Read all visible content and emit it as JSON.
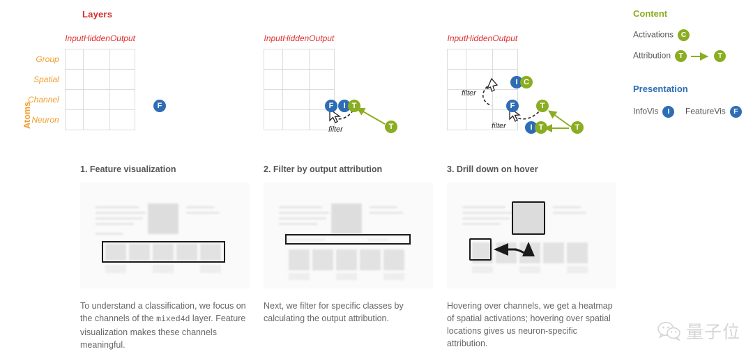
{
  "matrix": {
    "title": "Layers",
    "axis_label": "Atoms",
    "columns": [
      "Input",
      "Hidden",
      "Output"
    ],
    "rows": [
      "Group",
      "Spatial",
      "Channel",
      "Neuron"
    ],
    "filter_label": "filter",
    "panels": [
      {
        "name": "matrix-1",
        "badges": [
          {
            "text": "F",
            "color": "blue",
            "row": "Channel",
            "col": "Hidden"
          }
        ]
      },
      {
        "name": "matrix-2",
        "badges": [
          {
            "text": "F",
            "color": "blue",
            "row": "Channel",
            "col": "Hidden"
          },
          {
            "text": "I",
            "color": "blue",
            "row": "Channel",
            "col": "Hidden"
          },
          {
            "text": "T",
            "color": "green",
            "row": "Channel",
            "col": "Hidden"
          },
          {
            "text": "T",
            "color": "green",
            "row": "Neuron",
            "col": "Output"
          }
        ],
        "filters": [
          "filter"
        ]
      },
      {
        "name": "matrix-3",
        "badges": [
          {
            "text": "I",
            "color": "blue",
            "row": "Spatial",
            "col": "Hidden"
          },
          {
            "text": "C",
            "color": "green",
            "row": "Spatial",
            "col": "Hidden"
          },
          {
            "text": "F",
            "color": "blue",
            "row": "Channel",
            "col": "Hidden"
          },
          {
            "text": "T",
            "color": "green",
            "row": "Channel",
            "col": "Output"
          },
          {
            "text": "I",
            "color": "blue",
            "row": "Neuron",
            "col": "Hidden"
          },
          {
            "text": "T",
            "color": "green",
            "row": "Neuron",
            "col": "Hidden"
          },
          {
            "text": "T",
            "color": "green",
            "row": "Neuron",
            "col": "Output"
          }
        ],
        "filters": [
          "filter",
          "filter"
        ]
      }
    ]
  },
  "legend": {
    "content_heading": "Content",
    "presentation_heading": "Presentation",
    "activations_label": "Activations",
    "activations_badge": "C",
    "attribution_label": "Attribution",
    "attribution_badge_from": "T",
    "attribution_badge_to": "T",
    "infovis_label": "InfoVis",
    "infovis_badge": "I",
    "featurevis_label": "FeatureVis",
    "featurevis_badge": "F",
    "colors": {
      "content": "#8aad21",
      "presentation": "#2e6db4",
      "layers_title": "#d42b2b",
      "atoms_title": "#f0a030"
    }
  },
  "panels": [
    {
      "title": "1. Feature visualization",
      "caption_part1": "To understand a classification, we focus on the channels of the ",
      "caption_mono": "mixed4d",
      "caption_part2": " layer. Feature visualization makes these channels meaningful."
    },
    {
      "title": "2. Filter by output attribution",
      "caption_part1": "Next, we filter for specific classes by calculating the output attribution.",
      "caption_mono": "",
      "caption_part2": ""
    },
    {
      "title": "3. Drill down on hover",
      "caption_part1": "Hovering over channels, we get a heatmap of spatial activations; hovering over spatial locations gives us neuron-specific attribution.",
      "caption_mono": "",
      "caption_part2": ""
    }
  ],
  "watermark": {
    "text": "量子位",
    "icon": "wechat-icon"
  }
}
